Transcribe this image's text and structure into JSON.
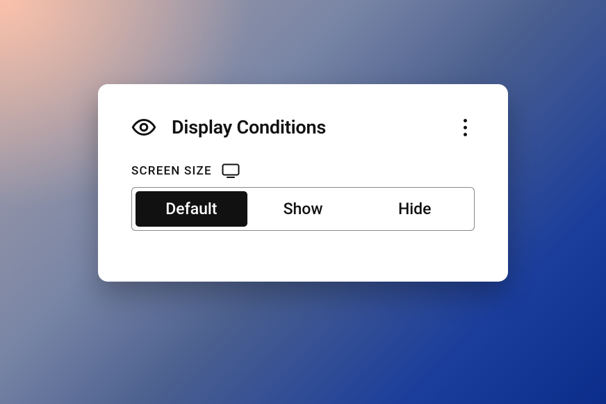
{
  "card": {
    "title": "Display Conditions",
    "sectionLabel": "SCREEN SIZE",
    "options": {
      "default": "Default",
      "show": "Show",
      "hide": "Hide"
    },
    "selected": "default"
  }
}
